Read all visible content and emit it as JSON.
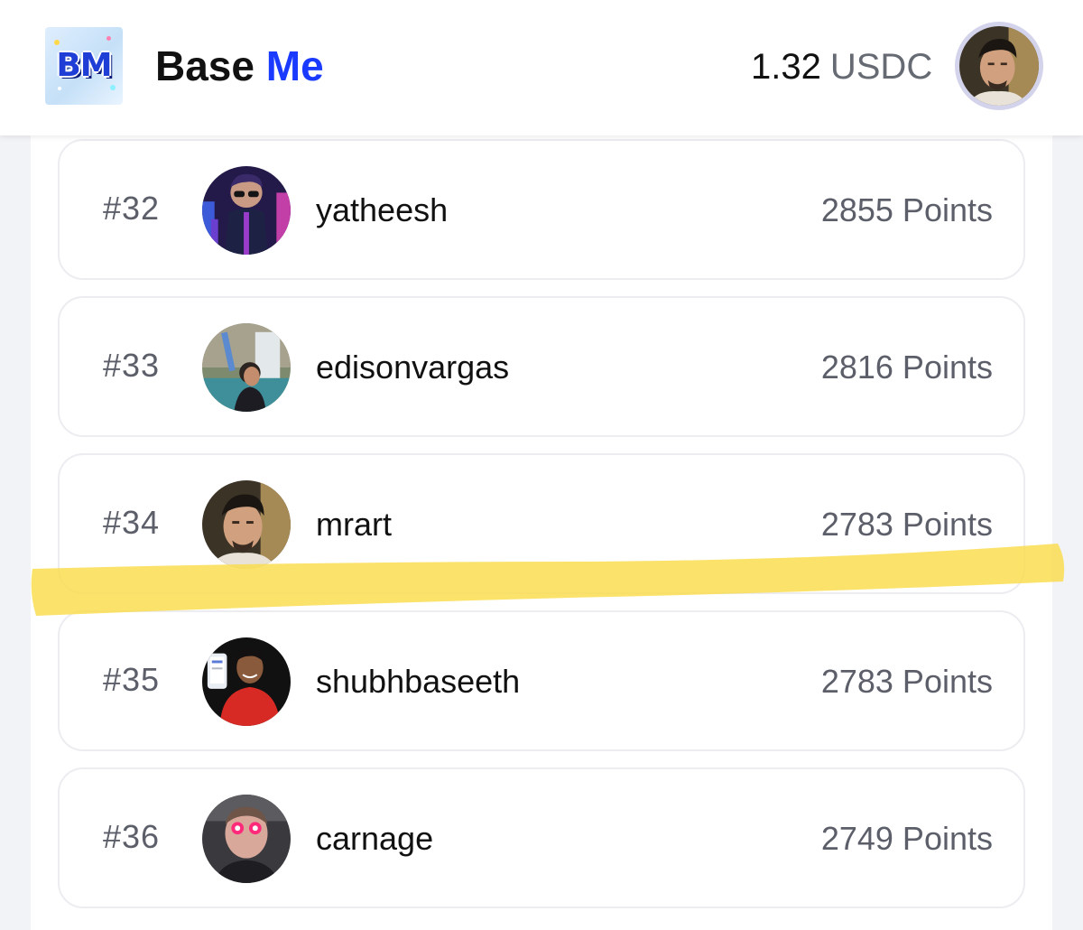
{
  "header": {
    "logo_text": "BM",
    "brand_primary": "Base",
    "brand_accent": "Me",
    "balance_amount": "1.32",
    "balance_unit": "USDC",
    "accent_color": "#1a3bff",
    "avatar_icon": "user-avatar"
  },
  "leaderboard": {
    "rows": [
      {
        "rank": "#32",
        "username": "yatheesh",
        "points": "2855 Points",
        "avatar": "3d-character-avatar"
      },
      {
        "rank": "#33",
        "username": "edisonvargas",
        "points": "2816 Points",
        "avatar": "waterfall-photo-avatar"
      },
      {
        "rank": "#34",
        "username": "mrart",
        "points": "2783 Points",
        "avatar": "portrait-avatar",
        "highlighted": true
      },
      {
        "rank": "#35",
        "username": "shubhbaseeth",
        "points": "2783 Points",
        "avatar": "red-hoodie-avatar"
      },
      {
        "rank": "#36",
        "username": "carnage",
        "points": "2749 Points",
        "avatar": "glowing-eyes-avatar"
      }
    ]
  },
  "highlight_color": "#f9dc4a"
}
